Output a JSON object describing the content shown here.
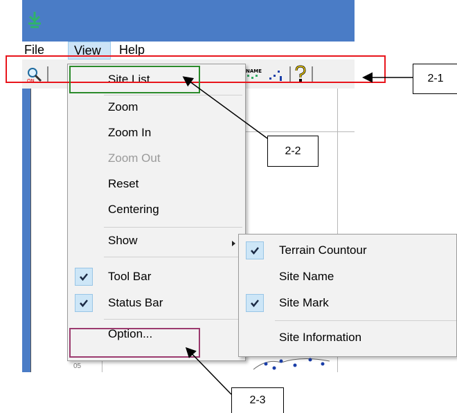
{
  "menubar": {
    "items": [
      {
        "label": "File"
      },
      {
        "label": "View"
      },
      {
        "label": "Help"
      }
    ]
  },
  "toolbar": {
    "icons": [
      "zoom-search-icon",
      "site-name-icon",
      "site-mark-icon",
      "help-icon"
    ],
    "site_name_icon_text": "NAME"
  },
  "view_menu": {
    "items": [
      {
        "label": "Site List"
      },
      {
        "label": "Zoom"
      },
      {
        "label": "Zoom In"
      },
      {
        "label": "Zoom Out",
        "disabled": true
      },
      {
        "label": "Reset"
      },
      {
        "label": "Centering"
      },
      {
        "label": "Show",
        "has_submenu": true
      },
      {
        "label": "Tool Bar",
        "checked": true
      },
      {
        "label": "Status Bar",
        "checked": true
      },
      {
        "label": "Option..."
      }
    ]
  },
  "show_submenu": {
    "items": [
      {
        "label": "Terrain Countour",
        "checked": true
      },
      {
        "label": "Site Name",
        "checked": false
      },
      {
        "label": "Site Mark",
        "checked": true
      },
      {
        "label": "Site Information",
        "checked": false
      }
    ]
  },
  "callouts": [
    {
      "label": "2-1"
    },
    {
      "label": "2-2"
    },
    {
      "label": "2-3"
    }
  ],
  "map": {
    "tick_label": "05"
  },
  "colors": {
    "title_bar": "#4a7cc6",
    "highlight_red": "#e8141b",
    "highlight_green": "#2a8a2a",
    "highlight_purple": "#9b3a6e",
    "check_bg": "#cde6f7"
  }
}
